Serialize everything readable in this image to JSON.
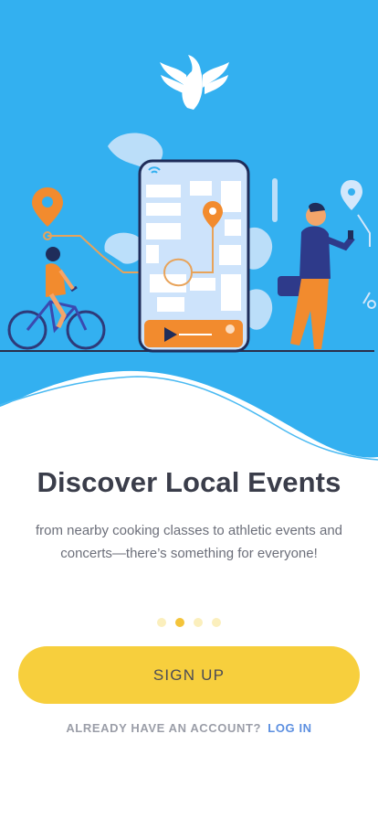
{
  "onboarding": {
    "title": "Discover Local Events",
    "subtitle": "from nearby cooking classes to athletic events and concerts—there’s something for everyone!",
    "page_count": 4,
    "active_page": 2
  },
  "actions": {
    "signup_label": "SIGN UP",
    "login_prompt": "ALREADY HAVE AN ACCOUNT?",
    "login_label": "LOG IN"
  },
  "icons": [
    "bird-logo-icon",
    "location-pin-icon",
    "wifi-icon",
    "phone-illustration",
    "cyclist-illustration",
    "walking-man-illustration"
  ],
  "colors": {
    "hero_background": "#33b0f0",
    "title": "#3a3d4a",
    "button": "#f7cf3d",
    "dot_active": "#f4c43a",
    "dot_inactive": "#fbefbd",
    "link": "#5c8fe0"
  }
}
